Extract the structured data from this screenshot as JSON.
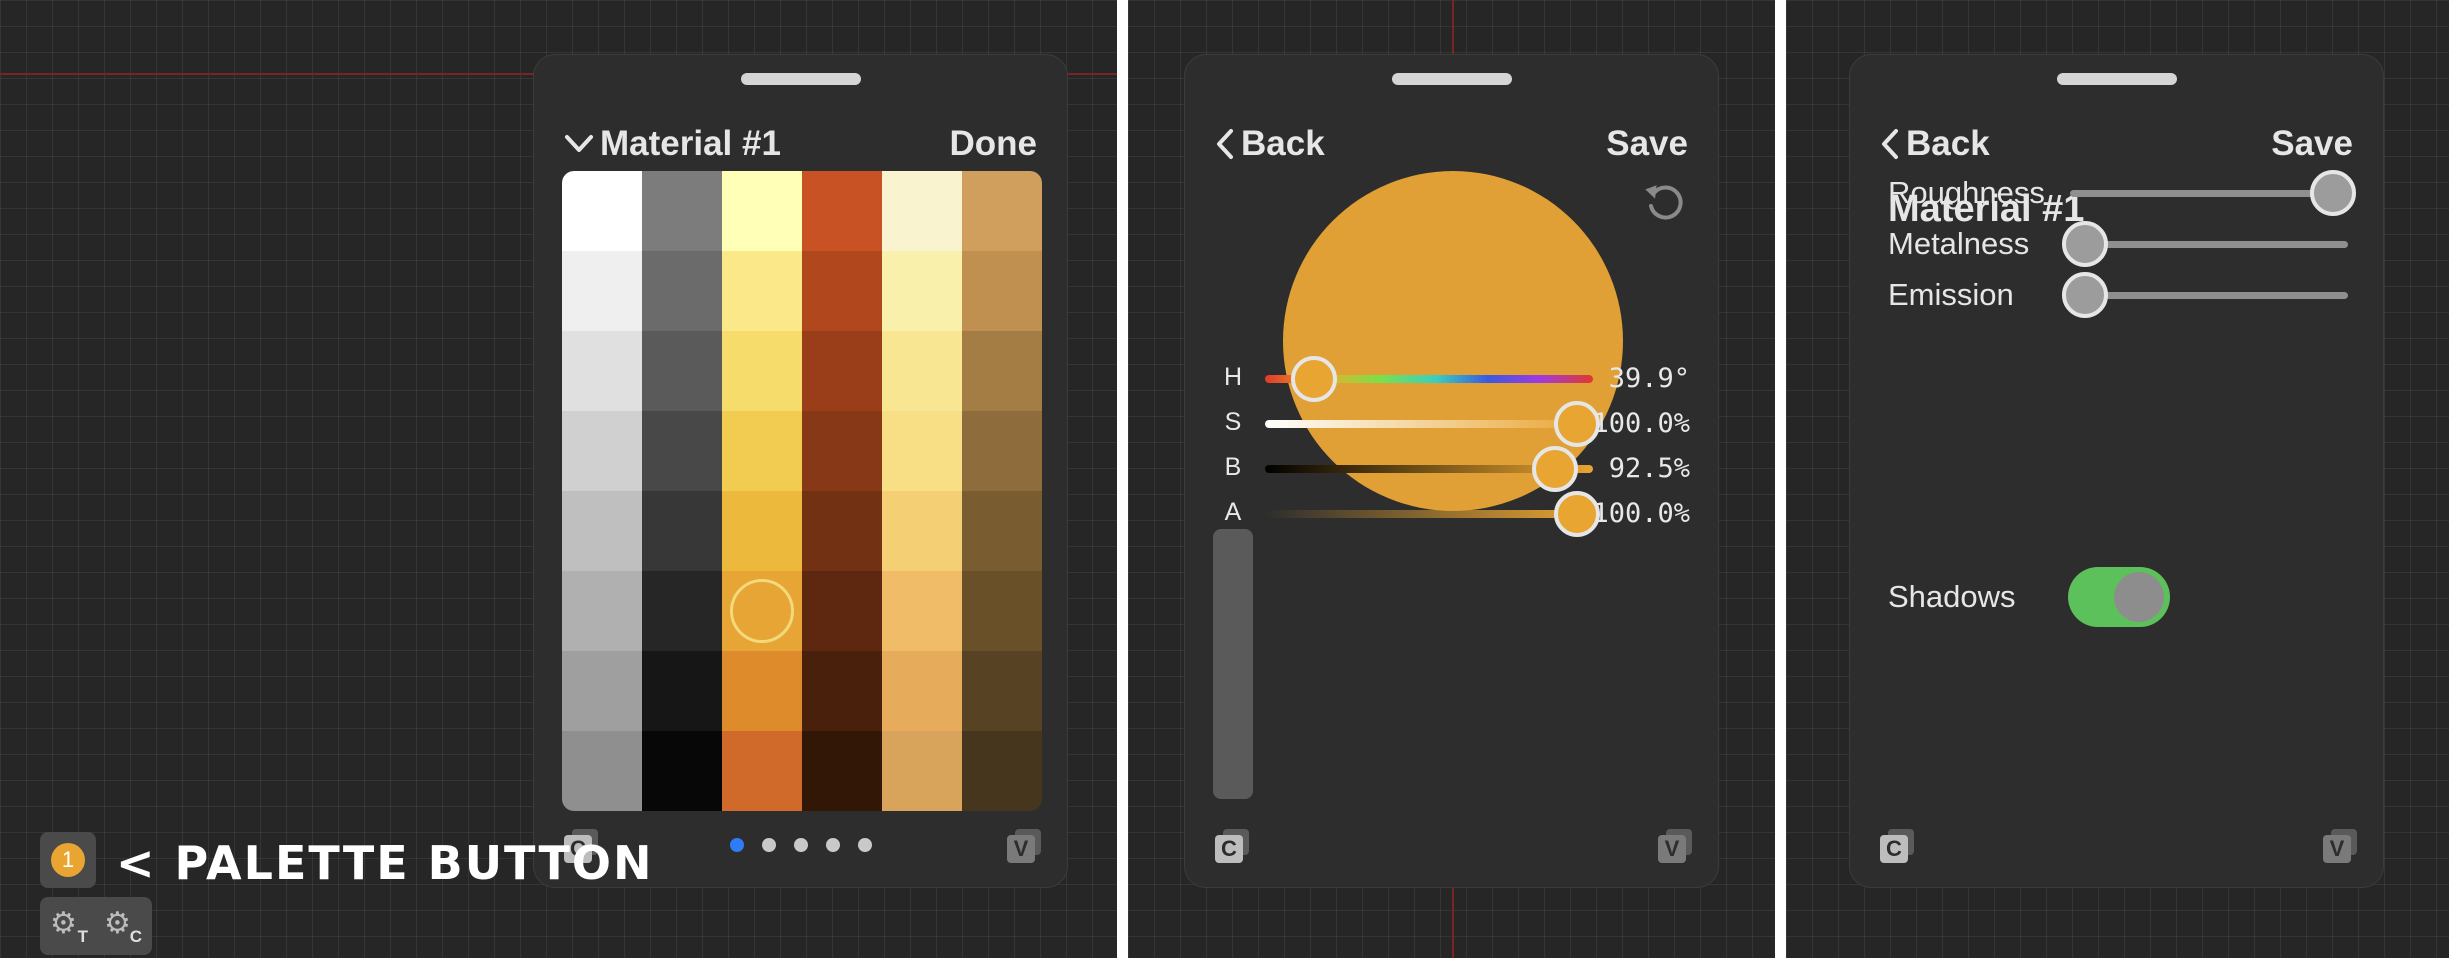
{
  "panel1": {
    "title": "Material #1",
    "done_label": "Done",
    "palette": [
      [
        "#ffffff",
        "#efefef",
        "#e0e0e0",
        "#d0d0d0",
        "#bfbfbf",
        "#b0b0b0",
        "#9f9f9f",
        "#8f8f8f"
      ],
      [
        "#7c7c7c",
        "#6b6b6b",
        "#5a5a5a",
        "#484848",
        "#373737",
        "#262626",
        "#161616",
        "#070707"
      ],
      [
        "#ffffb8",
        "#fbe989",
        "#f6dd6b",
        "#f2cc50",
        "#edb93d",
        "#e6a535",
        "#de8b2c",
        "#d06a2a"
      ],
      [
        "#c95225",
        "#b1471d",
        "#993e18",
        "#873816",
        "#733113",
        "#5e2810",
        "#49200c",
        "#331706"
      ],
      [
        "#faf3d0",
        "#f9f0ac",
        "#f8e693",
        "#f8de84",
        "#f4cf73",
        "#f0bc67",
        "#e7ab5c",
        "#d8a35b"
      ],
      [
        "#d09f5e",
        "#bf9050",
        "#a47d44",
        "#8e6c3b",
        "#7a5c31",
        "#6a5029",
        "#574323",
        "#46361d"
      ]
    ],
    "selected": {
      "col": 2,
      "row": 5
    },
    "page_dots": 5,
    "active_dot": 0,
    "copy_icon_label": "C",
    "paste_icon_label": "V",
    "badge_number": "1",
    "palette_button_label": "< PALETTE BUTTON",
    "tools": [
      {
        "icon": "gear-icon",
        "sub": "T"
      },
      {
        "icon": "gear-icon",
        "sub": "C"
      }
    ]
  },
  "panel2": {
    "back_label": "Back",
    "save_label": "Save",
    "swatch_color": "#e0a036",
    "sliders": [
      {
        "key": "H",
        "value_text": "39.9°",
        "position": 0.11
      },
      {
        "key": "S",
        "value_text": "100.0%",
        "position": 1.0
      },
      {
        "key": "B",
        "value_text": "92.5%",
        "position": 0.925
      },
      {
        "key": "A",
        "value_text": "100.0%",
        "position": 1.0
      }
    ],
    "copy_icon_label": "C",
    "paste_icon_label": "V"
  },
  "panel3": {
    "back_label": "Back",
    "save_label": "Save",
    "title": "Material #1",
    "properties": [
      {
        "label": "Roughness",
        "value": 1.0
      },
      {
        "label": "Metalness",
        "value": 0.0
      },
      {
        "label": "Emission",
        "value": 0.0
      }
    ],
    "shadows_label": "Shadows",
    "shadows_on": true,
    "copy_icon_label": "C",
    "paste_icon_label": "V"
  }
}
